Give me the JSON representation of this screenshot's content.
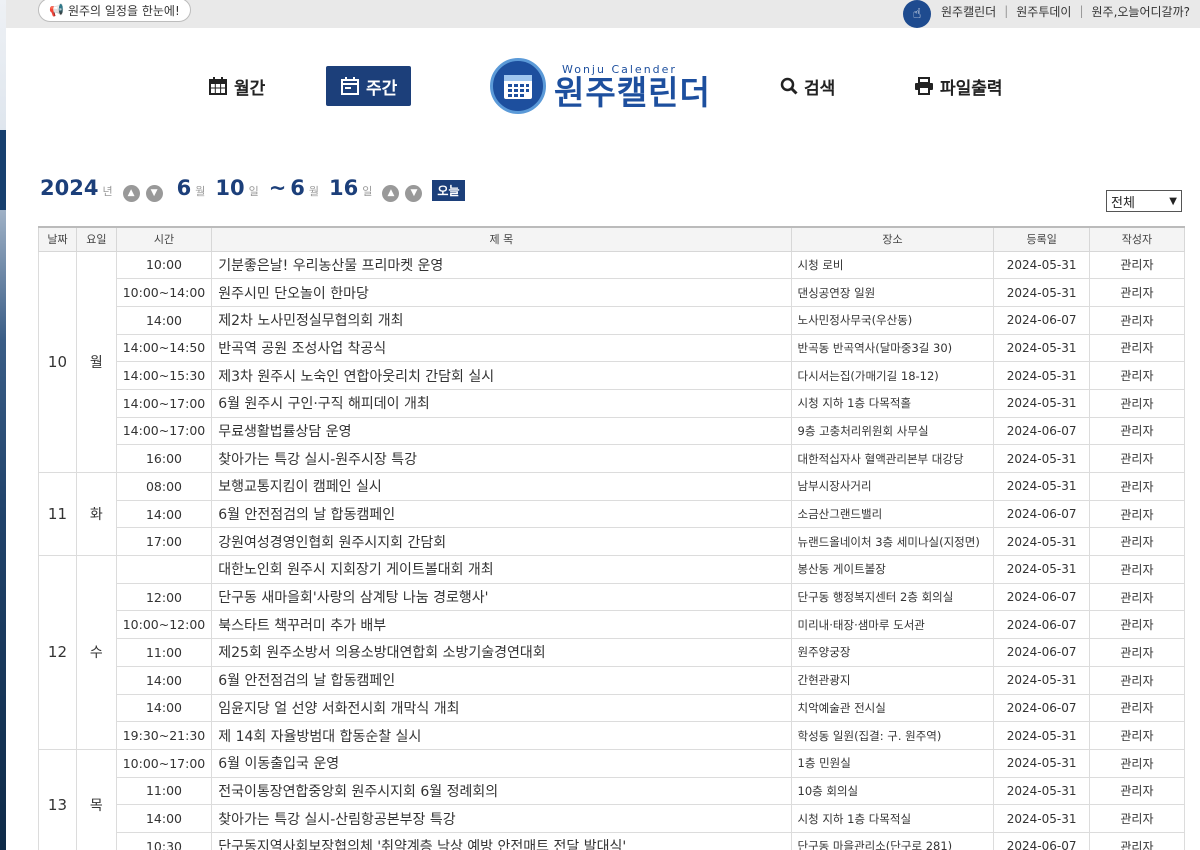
{
  "topbar": {
    "notice": "원주의 일정을 한눈에!",
    "links": [
      "원주캘린더",
      "원주투데이",
      "원주,오늘어디갈까?"
    ]
  },
  "nav": {
    "monthly": "월간",
    "weekly": "주간",
    "search": "검색",
    "print": "파일출력",
    "logo_sub": "Wonju Calender",
    "logo_main": "원주캘린더"
  },
  "range": {
    "year": "2024",
    "year_unit": "년",
    "start_month": "6",
    "month_unit": "월",
    "start_day": "10",
    "day_unit": "일",
    "tilde": "~",
    "end_month": "6",
    "end_day": "16",
    "today": "오늘"
  },
  "filter": {
    "selected": "전체"
  },
  "columns": [
    "날짜",
    "요일",
    "시간",
    "제 목",
    "장소",
    "등록일",
    "작성자"
  ],
  "days": [
    {
      "day": "10",
      "weekday": "월",
      "rows": [
        {
          "time": "10:00",
          "title": "기분좋은날! 우리농산물 프리마켓 운영",
          "place": "시청 로비",
          "date": "2024-05-31",
          "author": "관리자"
        },
        {
          "time": "10:00~14:00",
          "title": "원주시민 단오놀이 한마당",
          "place": "댄싱공연장 일원",
          "date": "2024-05-31",
          "author": "관리자"
        },
        {
          "time": "14:00",
          "title": "제2차 노사민정실무협의회 개최",
          "place": "노사민정사무국(우산동)",
          "date": "2024-06-07",
          "author": "관리자"
        },
        {
          "time": "14:00~14:50",
          "title": "반곡역 공원 조성사업 착공식",
          "place": "반곡동 반곡역사(달마중3길 30)",
          "date": "2024-05-31",
          "author": "관리자"
        },
        {
          "time": "14:00~15:30",
          "title": "제3차 원주시 노숙인 연합아웃리치 간담회 실시",
          "place": "다시서는집(가매기길 18-12)",
          "date": "2024-05-31",
          "author": "관리자"
        },
        {
          "time": "14:00~17:00",
          "title": "6월 원주시 구인·구직 해피데이 개최",
          "place": "시청 지하 1층 다목적홀",
          "date": "2024-05-31",
          "author": "관리자"
        },
        {
          "time": "14:00~17:00",
          "title": "무료생활법률상담 운영",
          "place": "9층 고충처리위원회 사무실",
          "date": "2024-06-07",
          "author": "관리자"
        },
        {
          "time": "16:00",
          "title": "찾아가는 특강 실시-원주시장 특강",
          "place": "대한적십자사 혈액관리본부 대강당",
          "date": "2024-05-31",
          "author": "관리자"
        }
      ]
    },
    {
      "day": "11",
      "weekday": "화",
      "rows": [
        {
          "time": "08:00",
          "title": "보행교통지킴이 캠페인 실시",
          "place": "남부시장사거리",
          "date": "2024-05-31",
          "author": "관리자"
        },
        {
          "time": "14:00",
          "title": "6월 안전점검의 날 합동캠페인",
          "place": "소금산그랜드밸리",
          "date": "2024-06-07",
          "author": "관리자"
        },
        {
          "time": "17:00",
          "title": "강원여성경영인협회 원주시지회 간담회",
          "place": "뉴랜드올네이처 3층 세미나실(지정면)",
          "date": "2024-05-31",
          "author": "관리자"
        }
      ]
    },
    {
      "day": "12",
      "weekday": "수",
      "rows": [
        {
          "time": "",
          "title": "대한노인회 원주시 지회장기 게이트볼대회 개최",
          "place": "봉산동 게이트볼장",
          "date": "2024-05-31",
          "author": "관리자"
        },
        {
          "time": "12:00",
          "title": "단구동 새마을회'사랑의 삼계탕 나눔 경로행사'",
          "place": "단구동 행정복지센터 2층 회의실",
          "date": "2024-06-07",
          "author": "관리자"
        },
        {
          "time": "10:00~12:00",
          "title": "북스타트 책꾸러미 추가 배부",
          "place": "미리내·태장·샘마루 도서관",
          "date": "2024-06-07",
          "author": "관리자"
        },
        {
          "time": "11:00",
          "title": "제25회 원주소방서 의용소방대연합회 소방기술경연대회",
          "place": "원주양궁장",
          "date": "2024-06-07",
          "author": "관리자"
        },
        {
          "time": "14:00",
          "title": "6월 안전점검의 날 합동캠페인",
          "place": "간현관광지",
          "date": "2024-05-31",
          "author": "관리자"
        },
        {
          "time": "14:00",
          "title": "임윤지당 얼 선양 서화전시회 개막식 개최",
          "place": "치악예술관 전시실",
          "date": "2024-06-07",
          "author": "관리자"
        },
        {
          "time": "19:30~21:30",
          "title": "제 14회 자율방범대 합동순찰 실시",
          "place": "학성동 일원(집결: 구. 원주역)",
          "date": "2024-05-31",
          "author": "관리자"
        }
      ]
    },
    {
      "day": "13",
      "weekday": "목",
      "rows": [
        {
          "time": "10:00~17:00",
          "title": "6월 이동출입국 운영",
          "place": "1층 민원실",
          "date": "2024-05-31",
          "author": "관리자"
        },
        {
          "time": "11:00",
          "title": "전국이통장연합중앙회 원주시지회 6월 정례회의",
          "place": "10층 회의실",
          "date": "2024-05-31",
          "author": "관리자"
        },
        {
          "time": "14:00",
          "title": "찾아가는 특강 실시-산림항공본부장 특강",
          "place": "시청 지하 1층 다목적실",
          "date": "2024-05-31",
          "author": "관리자"
        },
        {
          "time": "10:30",
          "title": "단구동지역사회보장협의체 '취약계층 낙상 예방 안전매트 전달 발대식'",
          "place": "단구동 마을관리소(단구로 281)",
          "date": "2024-06-07",
          "author": "관리자"
        }
      ]
    }
  ]
}
